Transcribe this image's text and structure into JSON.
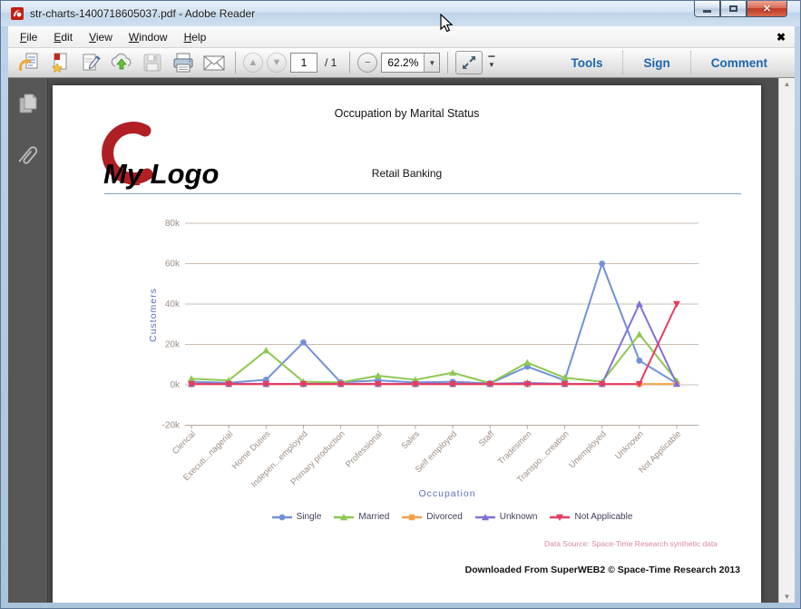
{
  "window": {
    "title": "str-charts-1400718605037.pdf - Adobe Reader"
  },
  "menu": {
    "items": [
      "File",
      "Edit",
      "View",
      "Window",
      "Help"
    ],
    "close_glyph": "✖"
  },
  "toolbar": {
    "page_current": "1",
    "page_total": "/ 1",
    "zoom_value": "62.2%",
    "tabs": {
      "tools": "Tools",
      "sign": "Sign",
      "comment": "Comment"
    }
  },
  "icons": {
    "minus_glyph": "−",
    "dropdown_glyph": "▼",
    "up_glyph": "▲",
    "down_glyph": "▼",
    "overflow_bar": "▔",
    "overflow_chevron": "▾"
  },
  "document": {
    "title": "Occupation by Marital Status",
    "logo_text": "My Logo",
    "subtitle": "Retail Banking",
    "data_source": "Data Source: Space-Time Research synthetic data",
    "footer": "Downloaded From SuperWEB2 © Space-Time Research 2013"
  },
  "chart_data": {
    "type": "line",
    "title": "Occupation by Marital Status",
    "xlabel": "Occupation",
    "ylabel": "Customers",
    "ylim": [
      -20000,
      80000
    ],
    "grid": true,
    "legend_position": "bottom",
    "yticks": [
      {
        "label": "80k",
        "value": 80000
      },
      {
        "label": "60k",
        "value": 60000
      },
      {
        "label": "40k",
        "value": 40000
      },
      {
        "label": "20k",
        "value": 20000
      },
      {
        "label": "0k",
        "value": 0
      },
      {
        "label": "-20k",
        "value": -20000
      }
    ],
    "categories": [
      "Clerical",
      "Executi...nagerial",
      "Home Duties",
      "Indepen...employed",
      "Primary production",
      "Professional",
      "Sales",
      "Self employed",
      "Staff",
      "Tradesmen",
      "Transpo...creation",
      "Unemployed",
      "Unknown",
      "Not Applicable"
    ],
    "series": [
      {
        "name": "Single",
        "color": "#7191d7",
        "marker": "circle",
        "values": [
          1500,
          1000,
          2500,
          21000,
          1200,
          2200,
          1200,
          1500,
          700,
          9000,
          2200,
          60000,
          12000,
          700
        ]
      },
      {
        "name": "Married",
        "color": "#8dc850",
        "marker": "triangle",
        "values": [
          3000,
          2200,
          17000,
          1500,
          1200,
          4500,
          2500,
          6000,
          800,
          11000,
          3500,
          1500,
          25000,
          2000
        ]
      },
      {
        "name": "Divorced",
        "color": "#f2a14d",
        "marker": "square",
        "values": [
          300,
          300,
          300,
          300,
          300,
          300,
          300,
          300,
          300,
          300,
          300,
          300,
          400,
          400
        ]
      },
      {
        "name": "Unknown",
        "color": "#8070d8",
        "marker": "triangle",
        "values": [
          500,
          500,
          500,
          500,
          500,
          500,
          500,
          500,
          500,
          900,
          500,
          500,
          40000,
          500
        ]
      },
      {
        "name": "Not Applicable",
        "color": "#e43d62",
        "marker": "triangle-down",
        "values": [
          400,
          400,
          400,
          400,
          400,
          400,
          400,
          400,
          400,
          400,
          400,
          400,
          400,
          40000
        ]
      }
    ],
    "axis_colors": {
      "grid": "#c9bdb3",
      "tick_label": "#9c8e84",
      "axis_title": "#5b6fb5"
    }
  }
}
